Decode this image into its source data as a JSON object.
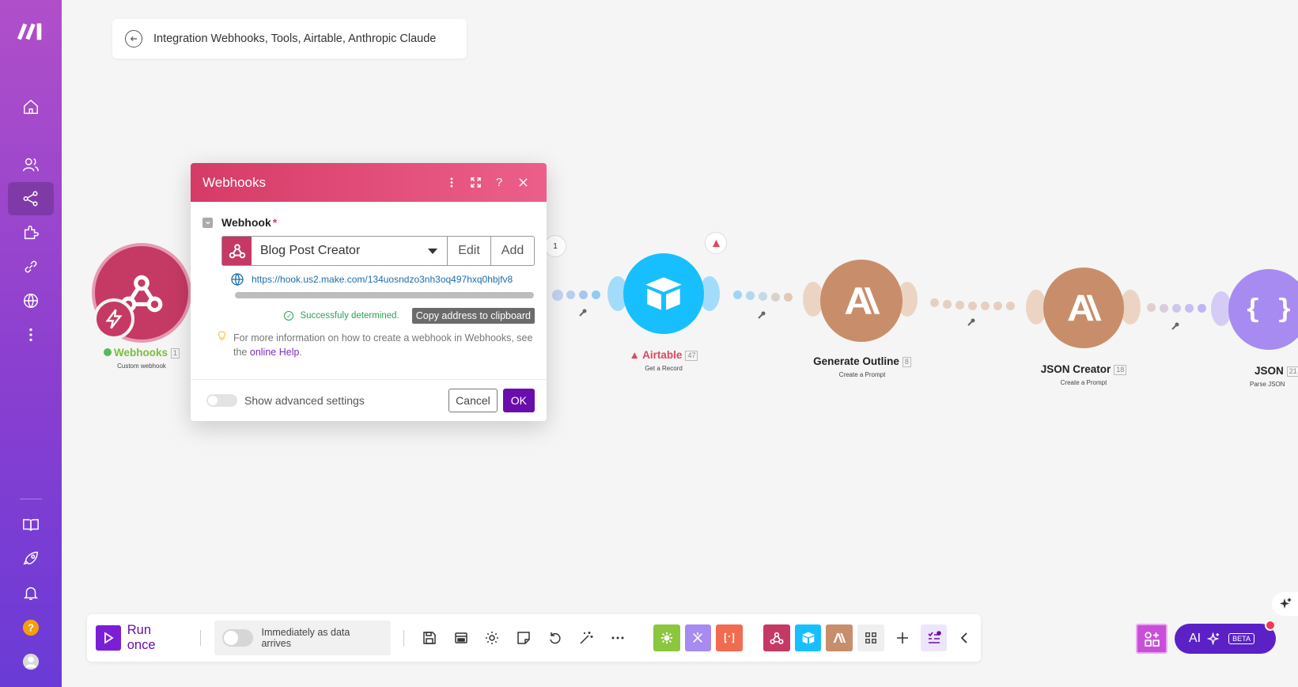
{
  "breadcrumb": {
    "title": "Integration Webhooks, Tools, Airtable, Anthropic Claude"
  },
  "sidebar": {
    "items": [
      "logo-icon",
      "home-icon",
      "team-icon",
      "scenarios-icon",
      "apps-icon",
      "connections-icon",
      "webhooks-icon",
      "more-icon",
      "docs-icon",
      "rocket-icon",
      "bell-icon",
      "help-icon",
      "avatar"
    ],
    "active": "scenarios-icon"
  },
  "colors": {
    "brand_purple": "#6a0dad",
    "webhook_red": "#c53a64",
    "airtable_blue": "#18bfff",
    "claude_tan": "#c88e6b",
    "json_purple": "#a78bf0"
  },
  "modules": [
    {
      "name": "Webhooks",
      "count": "1",
      "sub": "Custom webhook"
    },
    {
      "name": "Airtable",
      "count": "47",
      "sub": "Get a Record"
    },
    {
      "name": "Generate Outline",
      "count": "8",
      "sub": "Create a Prompt"
    },
    {
      "name": "JSON Creator",
      "count": "18",
      "sub": "Create a Prompt"
    },
    {
      "name": "JSON",
      "count": "21",
      "sub": "Parse JSON"
    }
  ],
  "route_count": "1",
  "dialog": {
    "title": "Webhooks",
    "field_label": "Webhook",
    "required_mark": "*",
    "selected": "Blog Post Creator",
    "edit": "Edit",
    "add": "Add",
    "url": "https://hook.us2.make.com/134uosndzo3nh3oq497hxq0hbjfv8",
    "status": "Successfuly determined.",
    "copy": "Copy address to clipboard",
    "help_text": "For more information on how to create a webhook in Webhooks, see the",
    "help_link": "online Help",
    "help_end": ".",
    "advanced": "Show advanced settings",
    "cancel": "Cancel",
    "ok": "OK"
  },
  "toolbar": {
    "run_label": "Run once",
    "schedule_label": "Immediately as data arrives"
  },
  "ai": {
    "label": "AI",
    "beta": "BETA"
  }
}
